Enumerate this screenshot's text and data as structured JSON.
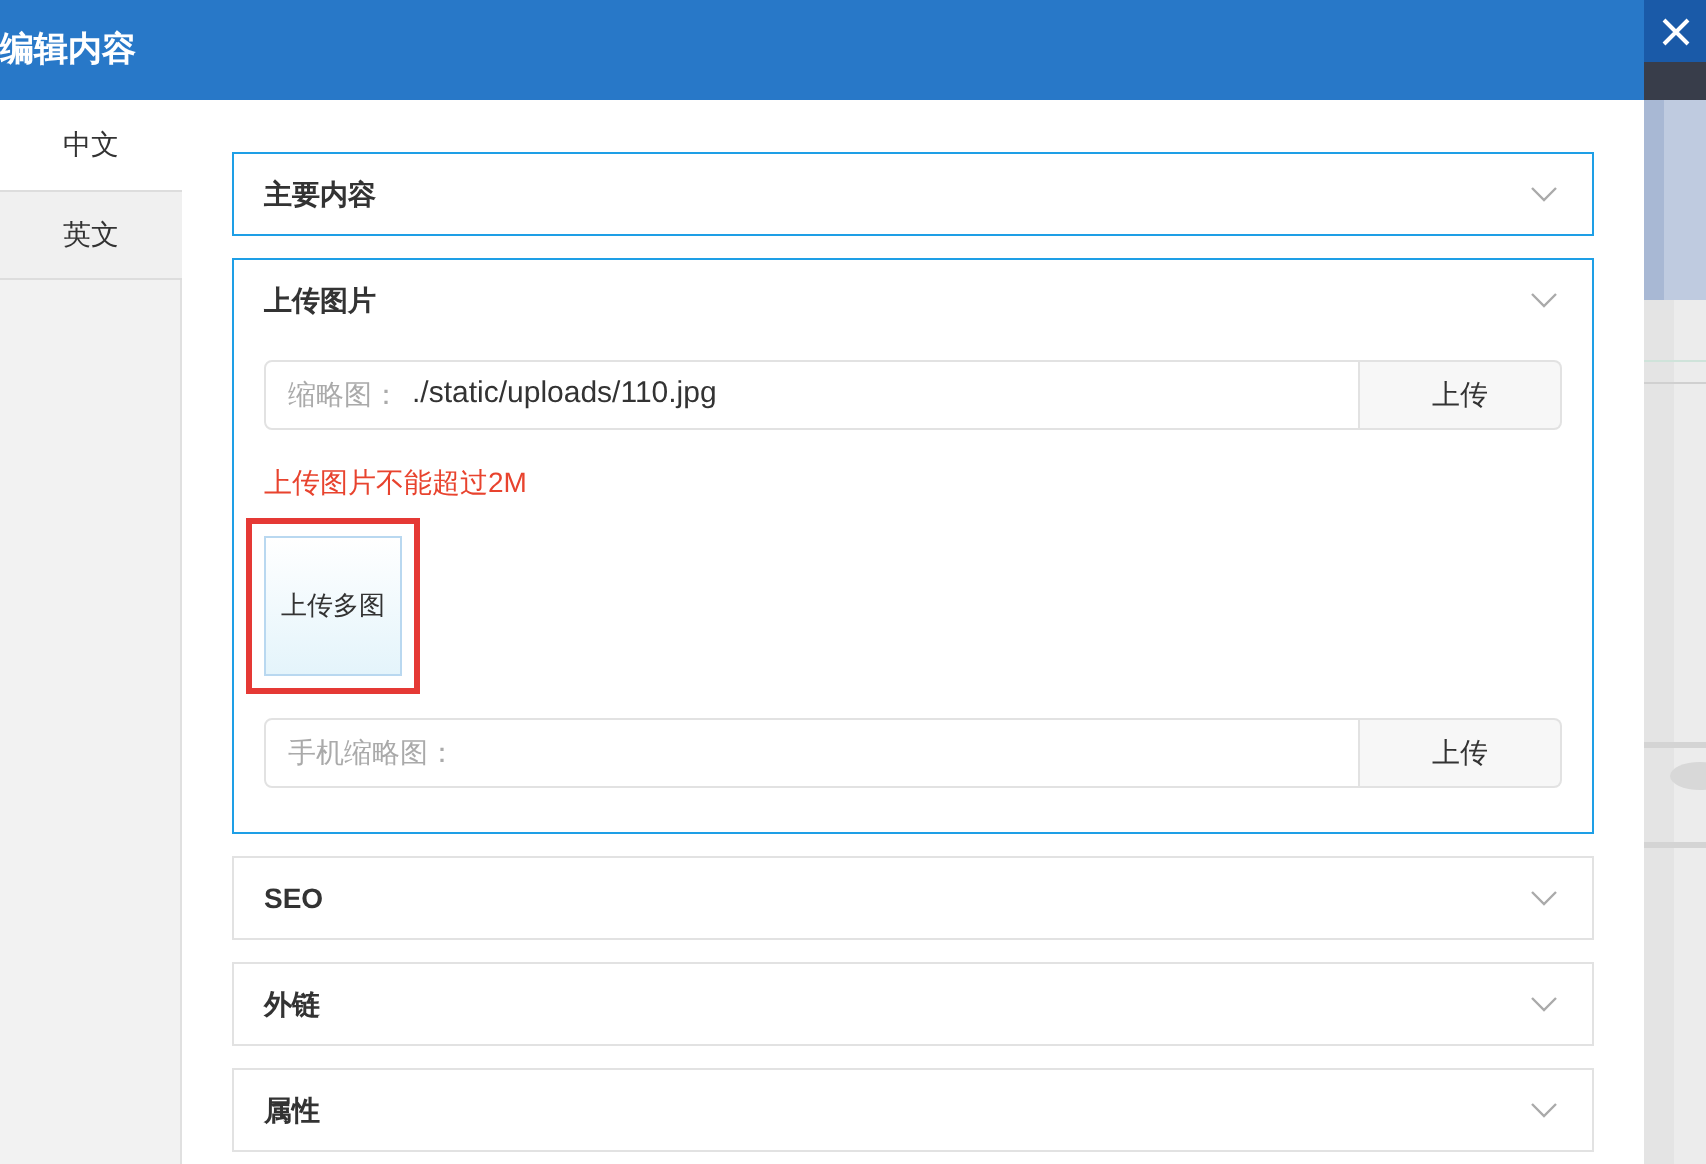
{
  "dialog": {
    "title": "编辑内容"
  },
  "tabs": [
    {
      "label": "中文",
      "selected": true
    },
    {
      "label": "英文",
      "selected": false
    }
  ],
  "sections": [
    {
      "title": "主要内容",
      "expanded": false,
      "highlighted": true
    },
    {
      "title": "上传图片",
      "expanded": true,
      "highlighted": true,
      "thumbnail": {
        "label": "缩略图：",
        "value": "./static/uploads/110.jpg",
        "button": "上传"
      },
      "note": "上传图片不能超过2M",
      "multi_upload": {
        "label": "上传多图",
        "outlined": true
      },
      "mobile_thumbnail": {
        "label": "手机缩略图：",
        "button": "上传"
      }
    },
    {
      "title": "SEO",
      "expanded": false,
      "highlighted": false
    },
    {
      "title": "外链",
      "expanded": false,
      "highlighted": false
    },
    {
      "title": "属性",
      "expanded": false,
      "highlighted": false
    }
  ]
}
